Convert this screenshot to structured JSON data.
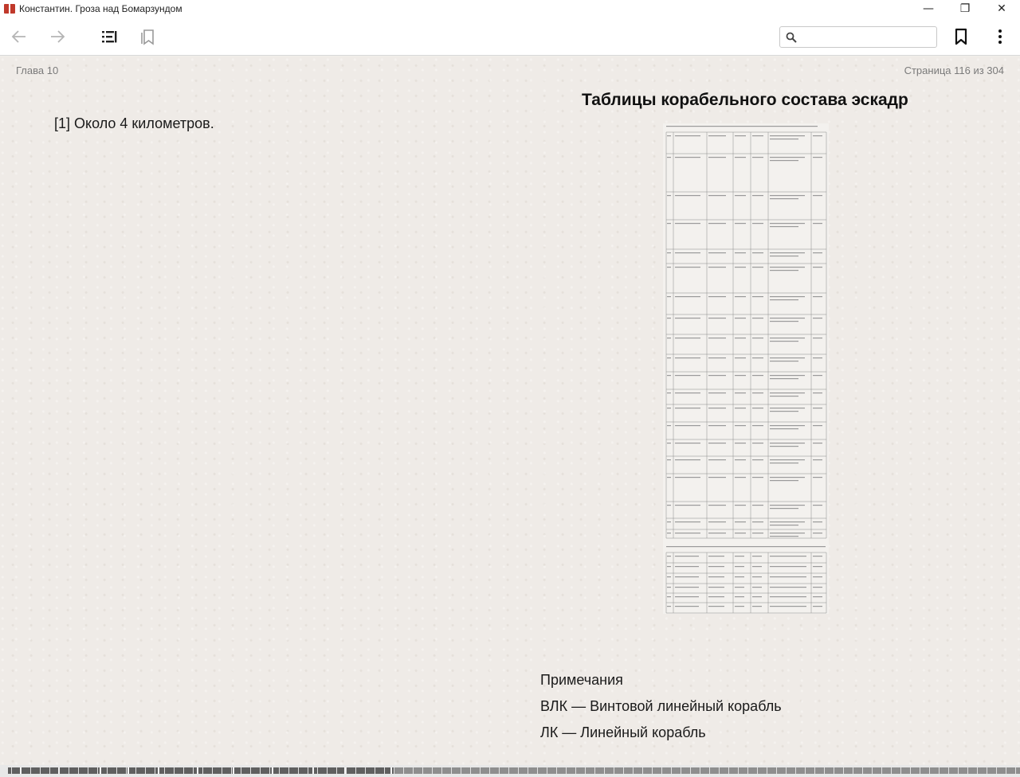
{
  "window": {
    "title": "Константин. Гроза над Бомарзундом",
    "minimize_glyph": "—",
    "maximize_glyph": "❐",
    "close_glyph": "✕"
  },
  "toolbar": {
    "back_icon": "arrow-left-icon",
    "forward_icon": "arrow-right-icon",
    "contents_icon": "table-of-contents-icon",
    "bookmarks_list_icon": "bookmarks-list-icon",
    "search_placeholder": "",
    "search_value": "",
    "bookmark_icon": "bookmark-icon",
    "menu_icon": "more-vertical-icon"
  },
  "page": {
    "chapter": "Глава 10",
    "page_indicator": "Страница 116 из 304",
    "footnote": "[1] Около 4 километров.",
    "tables_title": "Таблицы корабельного состава эскадр",
    "notes": [
      "Примечания",
      "ВЛК — Винтовой линейный корабль",
      "ЛК — Линейный корабль"
    ]
  },
  "progress": {
    "current_page": 116,
    "total_pages": 304
  },
  "colors": {
    "paper": "#efebe7",
    "progress_track": "#8e8e8e",
    "progress_fill": "#5f5f5f"
  }
}
